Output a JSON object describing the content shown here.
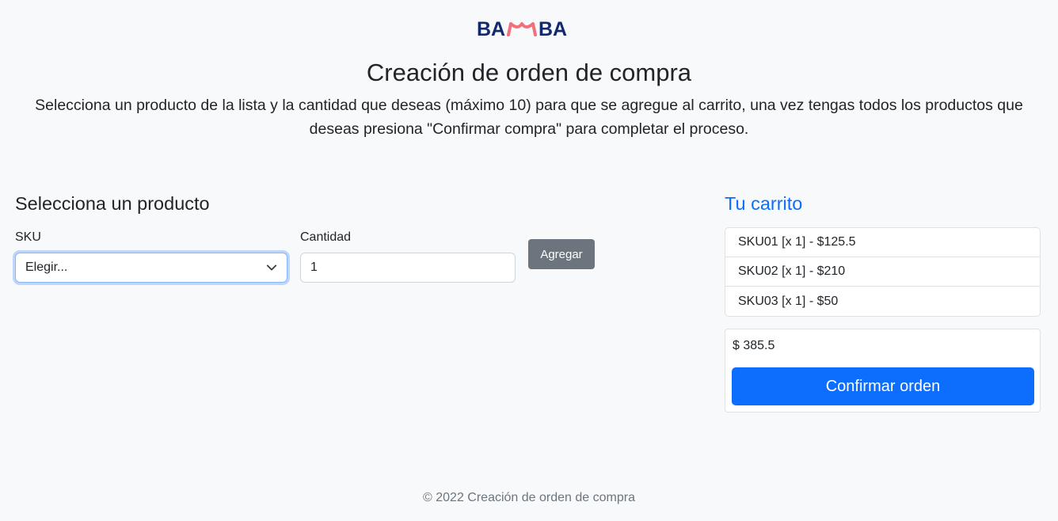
{
  "header": {
    "logo_text": "BAMBA",
    "title": "Creación de orden de compra",
    "lead": "Selecciona un producto de la lista y la cantidad que deseas (máximo 10) para que se agregue al carrito, una vez tengas todos los productos que deseas presiona \"Confirmar compra\" para completar el proceso."
  },
  "form": {
    "section_title": "Selecciona un producto",
    "sku_label": "SKU",
    "sku_selected": "Elegir...",
    "quantity_label": "Cantidad",
    "quantity_value": "1",
    "add_button": "Agregar"
  },
  "cart": {
    "title": "Tu carrito",
    "items": [
      "SKU01 [x 1] - $125.5",
      "SKU02 [x 1] - $210",
      "SKU03 [x 1] - $50"
    ],
    "total": "$ 385.5",
    "confirm_button": "Confirmar orden"
  },
  "footer": {
    "text": "© 2022 Creación de orden de compra"
  },
  "colors": {
    "brand_navy": "#12296b",
    "brand_accent": "#f2707a",
    "primary": "#0d6efd",
    "secondary": "#6c757d"
  }
}
